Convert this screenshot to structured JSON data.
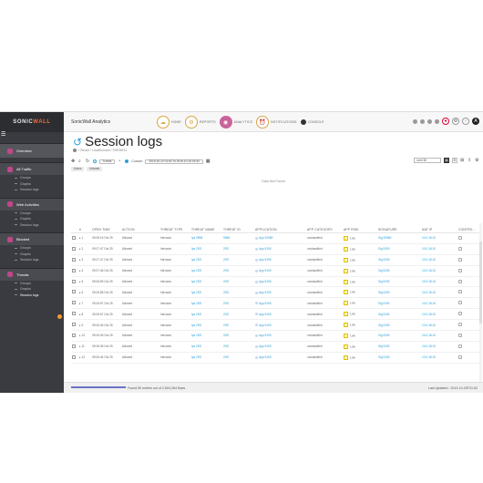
{
  "sidebar": {
    "logo_a": "SONIC",
    "logo_b": "WALL",
    "hamburger": "☰",
    "overview": "Overview",
    "sections": [
      {
        "label": "All Traffic",
        "items": [
          "Groups",
          "Graphs",
          "Session logs"
        ]
      },
      {
        "label": "Web Activities",
        "items": [
          "Groups",
          "Graphs",
          "Session logs"
        ]
      },
      {
        "label": "Blocked",
        "items": [
          "Groups",
          "Graphs",
          "Session logs"
        ]
      },
      {
        "label": "Threats",
        "items": [
          "Groups",
          "Graphs",
          "Session logs"
        ]
      }
    ]
  },
  "header": {
    "app_title": "SonicWall Analytics",
    "nav": [
      {
        "label": "HOME",
        "icon": "cloud-icon"
      },
      {
        "label": "REPORTS",
        "icon": "gear-icon"
      },
      {
        "label": "ANALYTICS",
        "icon": "analytics-icon"
      },
      {
        "label": "NOTIFICATIONS",
        "icon": "alarm-icon"
      },
      {
        "label": "CONSOLE",
        "icon": "console-icon"
      }
    ]
  },
  "page": {
    "title": "Session logs",
    "breadcrumb": "/ Tenant / LocalDomain / SSEW924"
  },
  "toolbar": {
    "time_value": "5 mins",
    "custom_label": "Custom",
    "date_range": "2019-10-22 01:52 To 2019-10-25 01:52",
    "rows_select": "Limit 50"
  },
  "filter": {
    "chip1": "Users",
    "chip2": "Intranet"
  },
  "no_data": "Data Not Found",
  "table": {
    "headers": [
      "",
      "#",
      "OPEN TIME",
      "ACTION",
      "THREAT TYPE",
      "THREAT NAME",
      "THREAT ID",
      "APPLICATION",
      "APP CATEGORY",
      "APP RISK",
      "SIGNATURE",
      "NAT IP",
      "CONTRO..."
    ],
    "rows": [
      {
        "n": "1",
        "time": "09:28:15 Oct 25",
        "action": "Allowed",
        "ttype": "Intrusion",
        "tname": "Ips 9968",
        "tid": "9968",
        "app": "App 32580",
        "cat": "unclassified",
        "risk": "Low",
        "sig": "Sig 32580",
        "nat": "10.0.18.10"
      },
      {
        "n": "2",
        "time": "09:27:47 Oct 25",
        "action": "Allowed",
        "ttype": "Intrusion",
        "tname": "Ips 2SS",
        "tid": "2SS",
        "app": "App 5190",
        "cat": "unclassified",
        "risk": "Low",
        "sig": "Sig 5190",
        "nat": "10.0.18.10"
      },
      {
        "n": "3",
        "time": "09:27:47 Oct 25",
        "action": "Allowed",
        "ttype": "Intrusion",
        "tname": "Ips 2SS",
        "tid": "2SS",
        "app": "App 5190",
        "cat": "unclassified",
        "risk": "Low",
        "sig": "Sig 5190",
        "nat": "10.0.18.10"
      },
      {
        "n": "4",
        "time": "09:27:46 Oct 25",
        "action": "Allowed",
        "ttype": "Intrusion",
        "tname": "Ips 2SS",
        "tid": "2SS",
        "app": "App 5190",
        "cat": "unclassified",
        "risk": "Low",
        "sig": "Sig 5190",
        "nat": "10.0.18.10"
      },
      {
        "n": "5",
        "time": "09:26:59 Oct 25",
        "action": "Allowed",
        "ttype": "Intrusion",
        "tname": "Ips 2SS",
        "tid": "2SS",
        "app": "App 5190",
        "cat": "unclassified",
        "risk": "Low",
        "sig": "Sig 5190",
        "nat": "10.0.18.10"
      },
      {
        "n": "6",
        "time": "09:26:58 Oct 25",
        "action": "Allowed",
        "ttype": "Intrusion",
        "tname": "Ips 2SS",
        "tid": "2SS",
        "app": "App 5190",
        "cat": "unclassified",
        "risk": "Low",
        "sig": "Sig 5190",
        "nat": "10.0.18.10"
      },
      {
        "n": "7",
        "time": "09:26:57 Oct 25",
        "action": "Allowed",
        "ttype": "Intrusion",
        "tname": "Ips 2SS",
        "tid": "2SS",
        "app": "App 5190",
        "cat": "unclassified",
        "risk": "Low",
        "sig": "Sig 5190",
        "nat": "10.0.18.10"
      },
      {
        "n": "8",
        "time": "09:26:57 Oct 25",
        "action": "Allowed",
        "ttype": "Intrusion",
        "tname": "Ips 2SS",
        "tid": "2SS",
        "app": "App 5190",
        "cat": "unclassified",
        "risk": "Low",
        "sig": "Sig 5190",
        "nat": "10.0.18.10"
      },
      {
        "n": "9",
        "time": "09:26:45 Oct 25",
        "action": "Allowed",
        "ttype": "Intrusion",
        "tname": "Ips 2SS",
        "tid": "2SS",
        "app": "App 5190",
        "cat": "unclassified",
        "risk": "Low",
        "sig": "Sig 5190",
        "nat": "10.0.18.10"
      },
      {
        "n": "10",
        "time": "09:26:45 Oct 25",
        "action": "Allowed",
        "ttype": "Intrusion",
        "tname": "Ips 2SS",
        "tid": "2SS",
        "app": "App 5190",
        "cat": "unclassified",
        "risk": "Low",
        "sig": "Sig 5190",
        "nat": "10.0.18.10"
      },
      {
        "n": "11",
        "time": "09:26:45 Oct 25",
        "action": "Allowed",
        "ttype": "Intrusion",
        "tname": "Ips 2SS",
        "tid": "2SS",
        "app": "App 5190",
        "cat": "unclassified",
        "risk": "Low",
        "sig": "Sig 5190",
        "nat": "10.0.18.10"
      },
      {
        "n": "12",
        "time": "09:26:44 Oct 25",
        "action": "Allowed",
        "ttype": "Intrusion",
        "tname": "Ips 2SS",
        "tid": "2SS",
        "app": "App 5190",
        "cat": "unclassified",
        "risk": "Low",
        "sig": "Sig 5190",
        "nat": "10.0.18.10"
      }
    ]
  },
  "status": {
    "found_text": "Found 50 entries out of 2,604,264 flows",
    "last_updated": "Last Updated : 2019-10-25T01:52"
  },
  "colors": {
    "accent": "#2a9fd6",
    "sidebar": "#3a3b40",
    "analytics_active": "#c9649a",
    "logo_accent": "#f26a3b"
  }
}
